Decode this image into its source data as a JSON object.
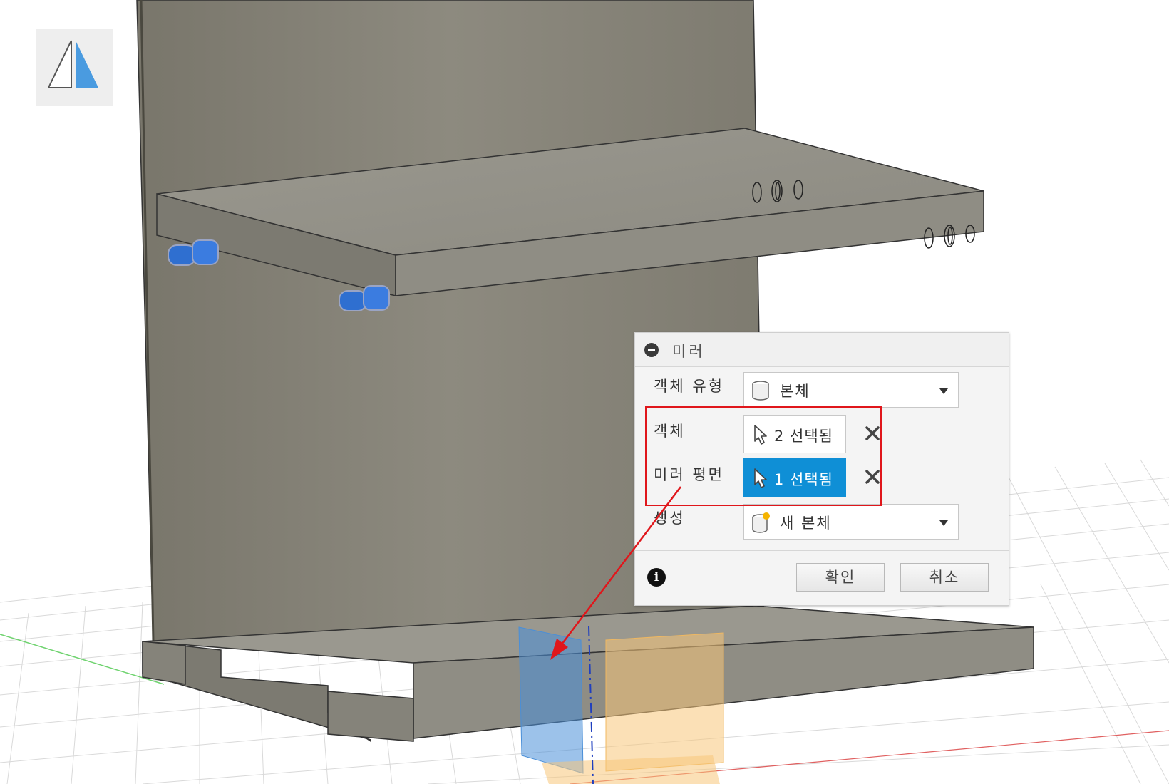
{
  "dialog": {
    "title": "미러",
    "object_type": {
      "label": "객체 유형",
      "value": "본체"
    },
    "objects": {
      "label": "객체",
      "selection": "2 선택됨"
    },
    "mirror_plane": {
      "label": "미러 평면",
      "selection": "1 선택됨"
    },
    "operation": {
      "label": "생성",
      "value": "새 본체"
    },
    "ok_label": "확인",
    "cancel_label": "취소"
  },
  "colors": {
    "selection_active": "#0f8fd6",
    "annotation_red": "#e0161b",
    "plane_blue": "#4a8fd8",
    "plane_orange": "#f7c77a",
    "pin_blue": "#2f6fd0"
  },
  "icons": [
    "mirror-tool-icon",
    "collapse-icon",
    "body-icon",
    "cursor-icon",
    "close-icon",
    "new-body-icon",
    "info-icon"
  ]
}
